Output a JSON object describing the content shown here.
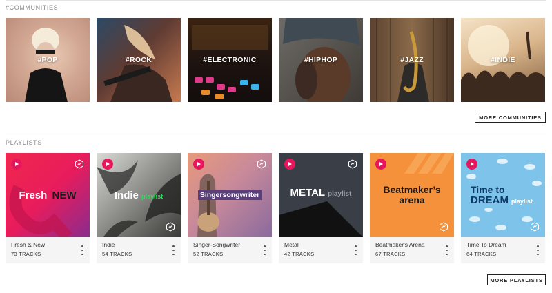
{
  "communities": {
    "heading": "#COMMUNITIES",
    "items": [
      {
        "tag": "#POP"
      },
      {
        "tag": "#ROCK"
      },
      {
        "tag": "#ELECTRONIC"
      },
      {
        "tag": "#HIPHOP"
      },
      {
        "tag": "#JAZZ"
      },
      {
        "tag": "#INDIE"
      }
    ],
    "more_label": "MORE COMMUNITIES"
  },
  "playlists": {
    "heading": "PLAYLISTS",
    "items": [
      {
        "name": "Fresh & New",
        "tracks": "73 TRACKS",
        "art_main": "Fresh",
        "art_accent": "NEW"
      },
      {
        "name": "Indie",
        "tracks": "54 TRACKS",
        "art_main": "Indie",
        "art_accent": "playlist"
      },
      {
        "name": "Singer-Songwriter",
        "tracks": "52 TRACKS",
        "art_main": "Singersongwriter"
      },
      {
        "name": "Metal",
        "tracks": "42 TRACKS",
        "art_main": "METAL",
        "art_accent": "playlist"
      },
      {
        "name": "Beatmaker's Arena",
        "tracks": "67 TRACKS",
        "art_main": "Beatmaker’s",
        "art_accent": "arena"
      },
      {
        "name": "Time To Dream",
        "tracks": "64 TRACKS",
        "art_main": "Time to",
        "art_accent": "DREAM",
        "art_suffix": "playlist"
      }
    ],
    "more_label": "MORE PLAYLISTS"
  },
  "icons": {
    "play": "play-icon",
    "badge": "hexagon-logo-icon",
    "menu": "more-vertical-icon"
  },
  "colors": {
    "play_accent": "#e8175d",
    "indie_accent": "#2bdc5c"
  }
}
